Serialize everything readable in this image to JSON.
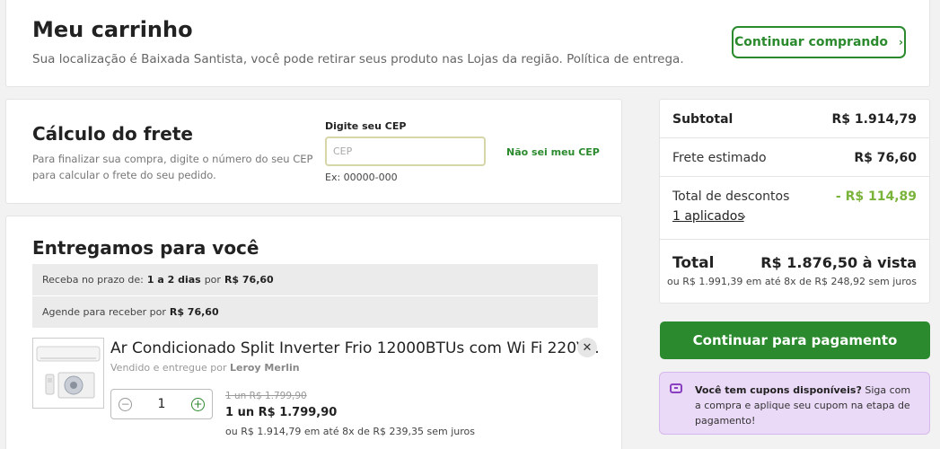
{
  "header": {
    "title": "Meu carrinho",
    "subtitle": "Sua localização é Baixada Santista, você pode retirar seus produto nas Lojas da região. Política de entrega.",
    "continue_label": "Continuar comprando"
  },
  "frete": {
    "title": "Cálculo do frete",
    "description": "Para finalizar sua compra, digite o número do seu CEP para calcular o frete do seu pedido.",
    "cep_label": "Digite seu CEP",
    "cep_placeholder": "CEP",
    "cep_value": "",
    "cep_example": "Ex: 00000-000",
    "nao_sei_label": "Não sei meu CEP"
  },
  "entrega": {
    "title": "Entregamos para você",
    "option1": {
      "prefix": "Receba no prazo de:",
      "days": "1 a 2 dias",
      "mid": "por",
      "price": "R$ 76,60"
    },
    "option2": {
      "prefix": "Agende para receber por",
      "price": "R$ 76,60"
    }
  },
  "product": {
    "name": "Ar Condicionado Split Inverter Frio 12000BTUs com Wi Fi 220V...",
    "seller_prefix": "Vendido e entregue por",
    "seller": "Leroy Merlin",
    "quantity": "1",
    "price_old": "1 un R$ 1.799,90",
    "price_now": "1 un R$ 1.799,90",
    "installments": "ou R$ 1.914,79 em até 8x de R$ 239,35 sem juros"
  },
  "summary": {
    "subtotal_label": "Subtotal",
    "subtotal_value": "R$ 1.914,79",
    "frete_label": "Frete estimado",
    "frete_value": "R$ 76,60",
    "descontos_label": "Total de descontos",
    "descontos_value": "- R$ 114,89",
    "aplicados_label": "1 aplicados",
    "total_label": "Total",
    "total_value": "R$ 1.876,50 à vista",
    "total_installments": "ou R$ 1.991,39 em até 8x de R$ 248,92 sem juros"
  },
  "payment_button": "Continuar para pagamento",
  "coupon": {
    "bold": "Você tem cupons disponíveis?",
    "text": " Siga com a compra e aplique seu cupom na etapa de pagamento!"
  },
  "colors": {
    "primary_green": "#2b8a2e",
    "discount_green": "#7ab33a",
    "coupon_bg": "#ead9f7",
    "coupon_icon": "#8a3fc0"
  },
  "icons": {
    "continue": "chevron-right-icon",
    "remove": "close-icon",
    "minus": "minus-circle-icon",
    "plus": "plus-circle-icon",
    "coupon": "ticket-icon"
  }
}
